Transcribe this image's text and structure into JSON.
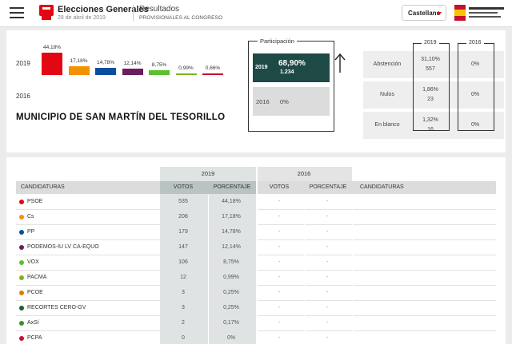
{
  "header": {
    "app_title": "Elecciones Generales",
    "app_date": "28 de abril de 2019",
    "results_title": "Resultados",
    "results_sub": "PROVISIONALES AL CONGRESO",
    "language": "Castellano"
  },
  "summary": {
    "year_current": "2019",
    "year_previous": "2016",
    "municipality": "MUNICIPIO DE SAN MARTÍN DEL TESORILLO",
    "chart_data": {
      "type": "bar",
      "categories": [
        "PSOE",
        "Cs",
        "PP",
        "PODEMOS-IU LV CA-EQUO",
        "VOX",
        "PACMA",
        "PCOE"
      ],
      "values": [
        44.18,
        17.18,
        14.78,
        12.14,
        8.75,
        0.99,
        0.66
      ],
      "labels": [
        "44,18%",
        "17,18%",
        "14,78%",
        "12,14%",
        "8,75%",
        "0,99%",
        "0,66%"
      ],
      "colors": [
        "#e30613",
        "#f39200",
        "#0a4f9e",
        "#6b1e5c",
        "#5bc02c",
        "#7ab51d",
        "#c8102e"
      ]
    }
  },
  "participation": {
    "title": "Participación",
    "y2019": "2019",
    "v2019": "68,90%",
    "n2019": "1.234",
    "y2016": "2016",
    "v2016": "0%"
  },
  "stats": {
    "col2019": "2019",
    "col2016": "2016",
    "rows": [
      {
        "label": "Abstención",
        "v2019_pct": "31,10%",
        "v2019_n": "557",
        "v2016": "0%"
      },
      {
        "label": "Nulos",
        "v2019_pct": "1,86%",
        "v2019_n": "23",
        "v2016": "0%"
      },
      {
        "label": "En blanco",
        "v2019_pct": "1,32%",
        "v2019_n": "16",
        "v2016": "0%"
      }
    ]
  },
  "table": {
    "year_current": "2019",
    "year_previous": "2016",
    "headers": {
      "candidaturas": "CANDIDATURAS",
      "votos": "VOTOS",
      "porcentaje": "PORCENTAJE",
      "votos16": "VOTOS",
      "porcentaje16": "PORCENTAJE",
      "candidaturas16": "CANDIDATURAS"
    },
    "rows": [
      {
        "name": "PSOE",
        "color": "#e30613",
        "votos": "535",
        "pct": "44,18%",
        "votos16": "-",
        "pct16": "-"
      },
      {
        "name": "Cs",
        "color": "#f39200",
        "votos": "208",
        "pct": "17,18%",
        "votos16": "-",
        "pct16": "-"
      },
      {
        "name": "PP",
        "color": "#0a4f9e",
        "votos": "179",
        "pct": "14,78%",
        "votos16": "-",
        "pct16": "-"
      },
      {
        "name": "PODEMOS-IU LV CA-EQUO",
        "color": "#6b1e5c",
        "votos": "147",
        "pct": "12,14%",
        "votos16": "-",
        "pct16": "-"
      },
      {
        "name": "VOX",
        "color": "#5bc02c",
        "votos": "106",
        "pct": "8,75%",
        "votos16": "-",
        "pct16": "-"
      },
      {
        "name": "PACMA",
        "color": "#7ab51d",
        "votos": "12",
        "pct": "0,99%",
        "votos16": "-",
        "pct16": "-"
      },
      {
        "name": "PCOE",
        "color": "#e07b00",
        "votos": "3",
        "pct": "0,25%",
        "votos16": "-",
        "pct16": "-"
      },
      {
        "name": "RECORTES CERO-GV",
        "color": "#1f5c2e",
        "votos": "3",
        "pct": "0,25%",
        "votos16": "-",
        "pct16": "-"
      },
      {
        "name": "AxSí",
        "color": "#3f8f2a",
        "votos": "2",
        "pct": "0,17%",
        "votos16": "-",
        "pct16": "-"
      },
      {
        "name": "PCPA",
        "color": "#c8102e",
        "votos": "0",
        "pct": "0%",
        "votos16": "-",
        "pct16": "-"
      }
    ]
  }
}
